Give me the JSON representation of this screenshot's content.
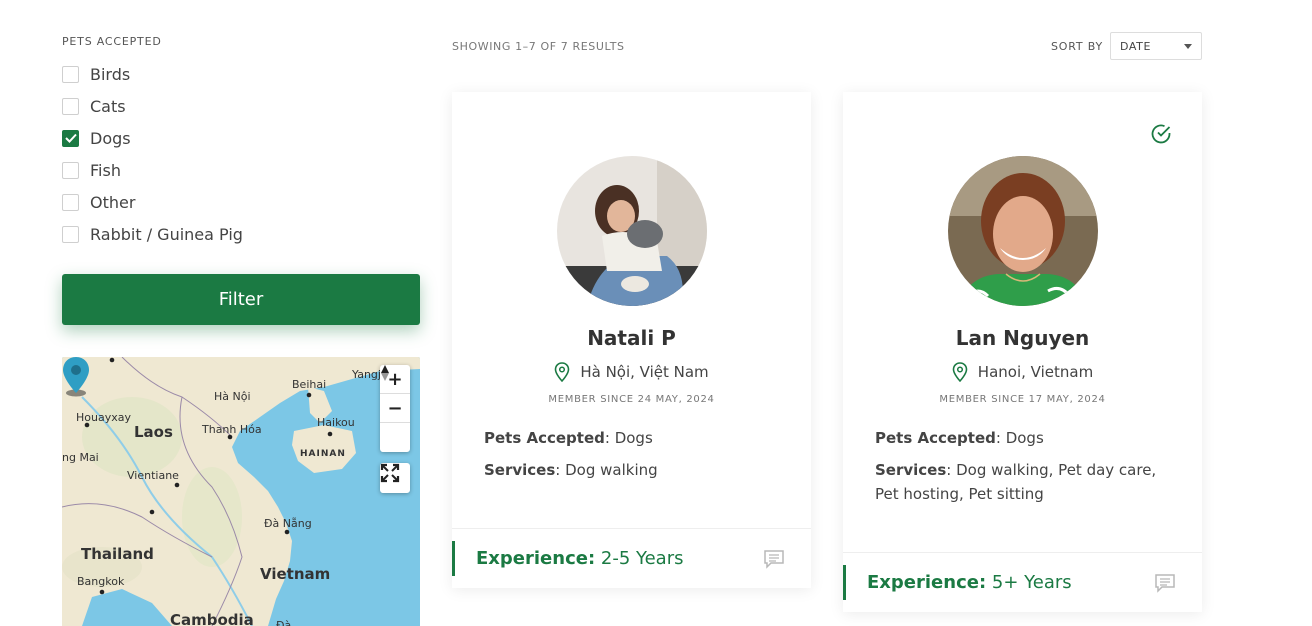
{
  "filters": {
    "section_label": "PETS ACCEPTED",
    "options": [
      {
        "label": "Birds",
        "checked": false
      },
      {
        "label": "Cats",
        "checked": false
      },
      {
        "label": "Dogs",
        "checked": true
      },
      {
        "label": "Fish",
        "checked": false
      },
      {
        "label": "Other",
        "checked": false
      },
      {
        "label": "Rabbit / Guinea Pig",
        "checked": false
      }
    ],
    "filter_button": "Filter"
  },
  "map": {
    "labels": {
      "laos": "Laos",
      "thailand": "Thailand",
      "vietnam": "Vietnam",
      "cambodia": "Cambodia",
      "houayxay": "Houayxay",
      "thanh_hoa": "Thanh Hóa",
      "beihai": "Beihai",
      "yangjiang": "Yangj",
      "haikou": "Haikou",
      "hainan": "HAINAN",
      "vientiane": "Vientiane",
      "da_nang": "Đà Nẵng",
      "bangkok": "Bangkok",
      "hanoi": "Hà Nội",
      "phongsali": "ng Mai",
      "dilat": "Đà"
    },
    "zoom_in": "+",
    "zoom_out": "−",
    "compass": "▲"
  },
  "results": {
    "count_text": "SHOWING 1–7 OF 7 RESULTS",
    "sort_label": "SORT BY",
    "sort_value": "DATE"
  },
  "cards": [
    {
      "name": "Natali P",
      "location": "Hà Nội, Việt Nam",
      "member_since": "MEMBER SINCE 24 MAY, 2024",
      "pets_label": "Pets Accepted",
      "pets_value": ": Dogs",
      "services_label": "Services",
      "services_value": ": Dog walking",
      "experience_label": "Experience:",
      "experience_value": " 2-5 Years",
      "verified": false
    },
    {
      "name": "Lan Nguyen",
      "location": "Hanoi, Vietnam",
      "member_since": "MEMBER SINCE 17 MAY, 2024",
      "pets_label": "Pets Accepted",
      "pets_value": ": Dogs",
      "services_label": "Services",
      "services_value": ": Dog walking, Pet day care, Pet hosting, Pet sitting",
      "experience_label": "Experience:",
      "experience_value": " 5+ Years",
      "verified": true
    }
  ],
  "colors": {
    "accent": "#1b7a43",
    "sea": "#7cc7e6",
    "land": "#efe8d2"
  }
}
